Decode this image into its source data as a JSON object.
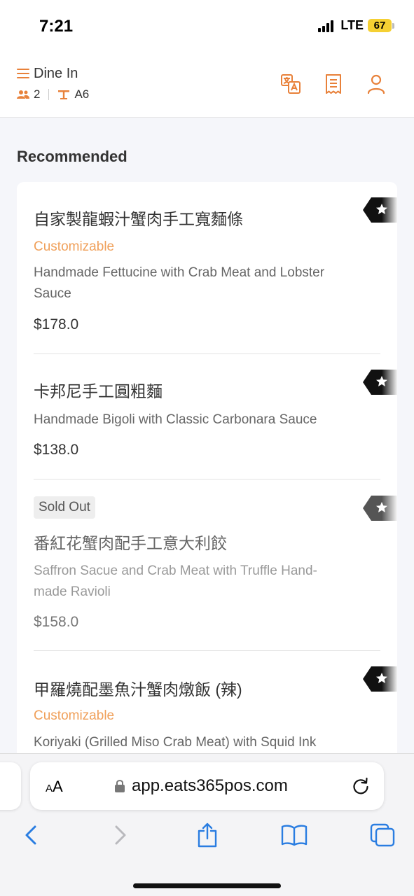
{
  "status": {
    "time": "7:21",
    "network": "LTE",
    "battery": "67"
  },
  "header": {
    "title": "Dine In",
    "guests": "2",
    "table": "A6",
    "icons": [
      "menu-icon",
      "translate-icon",
      "receipt-icon",
      "user-icon"
    ],
    "accent_color": "#e8813a"
  },
  "section": {
    "title": "Recommended"
  },
  "items": [
    {
      "name_zh": "自家製龍蝦汁蟹肉手工寬麵條",
      "customizable": "Customizable",
      "name_en_1": "Handmade Fettucine with Crab Meat and Lobster",
      "name_en_2": "Sauce",
      "price": "$178.0"
    },
    {
      "name_zh": "卡邦尼手工圓粗麵",
      "name_en_1": "Handmade Bigoli with Classic Carbonara Sauce",
      "price": "$138.0"
    },
    {
      "badge": "Sold Out",
      "name_zh": "番紅花蟹肉配手工意大利餃",
      "name_en_1": "Saffron Sacue and Crab Meat with Truffle Hand-",
      "name_en_2": "made Ravioli",
      "price": "$158.0"
    },
    {
      "name_zh": "甲羅燒配墨魚汁蟹肉燉飯 (辣)",
      "customizable": "Customizable",
      "name_en_1": "Koriyaki (Grilled Miso Crab Meat) with Squid Ink"
    }
  ],
  "browser": {
    "aa_small": "A",
    "aa_large": "A",
    "url": "app.eats365pos.com"
  }
}
